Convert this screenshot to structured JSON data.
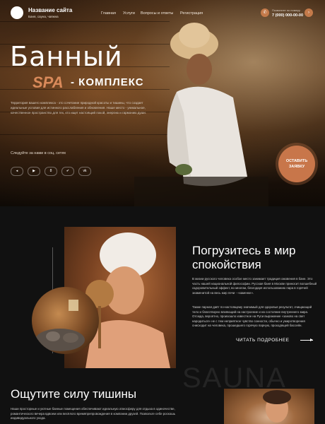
{
  "header": {
    "site_title": "Название сайта",
    "site_subtitle": "Баня, сауна, чаяжна",
    "nav": [
      "Главная",
      "Услуги",
      "Вопросы и ответы",
      "Регистрация"
    ],
    "phone_label": "Позвоните по номеру",
    "phone": "7 (000) 000-00-00"
  },
  "hero": {
    "title": "Банный",
    "spa": "SPA",
    "subtitle": "- КОМПЛЕКС",
    "description": "Территория вашего комплекса - это сочетание природной красоты и тишины, что создает идеальные условия для истинного расслабления и обновления. Наше место - уникальное, качественное пространство для тех, кто ищет настоящий покой, энергию и гармонию души.",
    "follow": "Следуйте за нами в соц. сетях",
    "socials": [
      "telegram-icon",
      "youtube-icon",
      "odnoklassniki-icon",
      "twitter-icon",
      "vk-icon"
    ],
    "cta": "ОСТАВИТЬ ЗАЯВКУ"
  },
  "about": {
    "title_line1": "Погрузитесь в мир",
    "title_line2": "спокойствия",
    "p1": "В жизни русского человека особое место занимает традиция омовения в бане. Это часть нашей национальной философии. Русская баня в Москве приносит волшебный оздоровительный эффект, во многом, благодаря использованию пара в горячей знаменитой на весь мир печи - «каменке».",
    "p2": "Также парная даёт по-настоящему значимый для здоровья результат, очищающий тело и благотворно влияющий на настроение и на состояние внутреннего мира. Отсюда, вероятно, произошло известное на Руси выражение «заново на свет народиться» не с тем неприятное чувство сонности, обычно и умиротворения снисходит на человека, прошедшего горячую парную, проходящей бассейн.",
    "read_more": "ЧИТАТЬ ПОДРОБНЕЕ",
    "watermark": "SAUNA"
  },
  "silence": {
    "title": "Ощутите силу тишины",
    "text": "Наши просторные и уютные банные помещения обеспечивают идеальную атмосферу для отдыха в одиночестве, романтического вечера вдвоем или весёлого времяпрепровождения в компании друзей. Позвольте себе роскошь индивидуального ухода."
  },
  "colors": {
    "accent": "#c8764a",
    "bg": "#111111",
    "spa": "#d98a5a"
  }
}
